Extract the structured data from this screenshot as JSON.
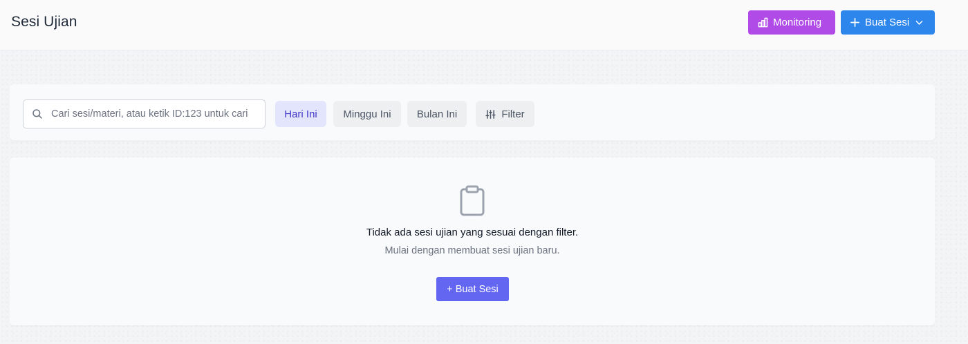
{
  "header": {
    "title": "Sesi Ujian",
    "monitoring_label": "Monitoring",
    "create_session_label": "Buat Sesi"
  },
  "filters": {
    "search_placeholder": "Cari sesi/materi, atau ketik ID:123 untuk cari",
    "search_value": "",
    "chips": [
      {
        "label": "Hari Ini",
        "active": true
      },
      {
        "label": "Minggu Ini",
        "active": false
      },
      {
        "label": "Bulan Ini",
        "active": false
      }
    ],
    "filter_label": "Filter"
  },
  "empty_state": {
    "icon": "clipboard-icon",
    "title": "Tidak ada sesi ujian yang sesuai dengan filter.",
    "subtitle": "Mulai dengan membuat sesi ujian baru.",
    "cta_label": "+ Buat Sesi"
  },
  "colors": {
    "monitoring": "#b04be8",
    "primary": "#2d86ec",
    "cta": "#6366f1",
    "chip_active_bg": "#e2e5fb",
    "chip_active_text": "#4338ca"
  },
  "icons": {
    "monitoring": "bar-chart-icon",
    "create": "plus-icon",
    "dropdown": "chevron-down-icon",
    "search": "search-icon",
    "filter": "sliders-icon"
  }
}
